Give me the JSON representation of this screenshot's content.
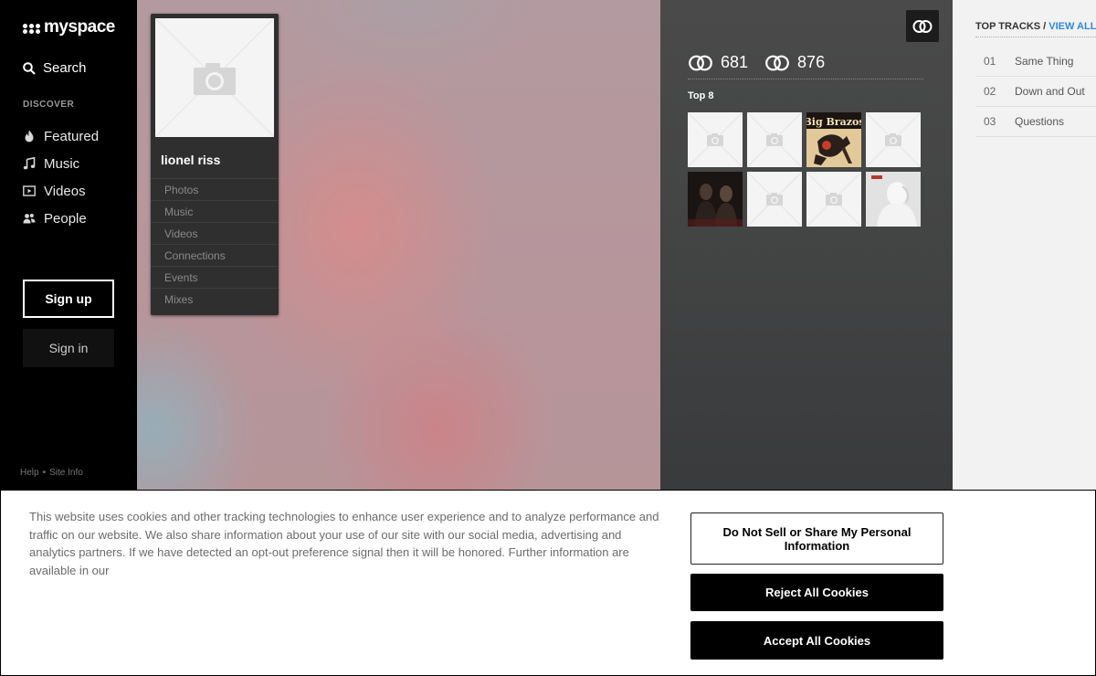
{
  "sidebar": {
    "logo_text": "myspace",
    "search_label": "Search",
    "discover_heading": "DISCOVER",
    "nav": [
      {
        "label": "Featured",
        "icon": "flame-icon"
      },
      {
        "label": "Music",
        "icon": "music-note-icon"
      },
      {
        "label": "Videos",
        "icon": "video-play-icon"
      },
      {
        "label": "People",
        "icon": "people-icon"
      }
    ],
    "signup_label": "Sign up",
    "signin_label": "Sign in",
    "footer_help": "Help",
    "footer_separator": "•",
    "footer_siteinfo": "Site Info"
  },
  "profile": {
    "name": "lionel riss",
    "menu": [
      "Photos",
      "Music",
      "Videos",
      "Connections",
      "Events",
      "Mixes"
    ]
  },
  "stats": {
    "connections_out": "681",
    "connections_in": "876"
  },
  "top8": {
    "label": "Top 8",
    "tiles": [
      {
        "type": "placeholder"
      },
      {
        "type": "placeholder"
      },
      {
        "type": "album",
        "title": "Big Brazos"
      },
      {
        "type": "placeholder"
      },
      {
        "type": "photo"
      },
      {
        "type": "placeholder"
      },
      {
        "type": "placeholder"
      },
      {
        "type": "photo-light"
      }
    ]
  },
  "tracks": {
    "header_prefix": "TOP TRACKS /",
    "view_all": "VIEW ALL",
    "items": [
      {
        "num": "01",
        "title": "Same Thing"
      },
      {
        "num": "02",
        "title": "Down and Out"
      },
      {
        "num": "03",
        "title": "Questions"
      }
    ]
  },
  "cookie": {
    "text": "This website uses cookies and other tracking technologies to enhance user experience and to analyze performance and traffic on our website. We also share information about your use of our site with our social media, advertising and analytics partners. If we have detected an opt-out preference signal then it will be honored. Further information are available in our",
    "do_not_sell_label": "Do Not Sell or Share My Personal Information",
    "reject_label": "Reject All Cookies",
    "accept_label": "Accept All Cookies"
  },
  "colors": {
    "accent_link": "#2f8ad9",
    "sidebar_bg": "#000000",
    "panel_bg": "#424343"
  }
}
